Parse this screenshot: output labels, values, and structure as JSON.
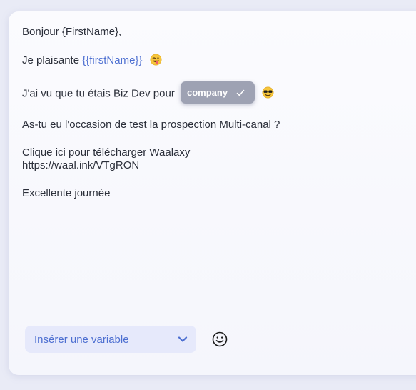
{
  "message": {
    "greeting": "Bonjour {FirstName},",
    "line2_text": "Je plaisante ",
    "line2_variable": "{{firstName}}",
    "line3_text": "J'ai vu que tu étais Biz Dev pour",
    "chip_label": "company",
    "line4": "As-tu eu l'occasion de test la prospection Multi-canal ?",
    "line5": "Clique ici pour télécharger Waalaxy",
    "line6": "https://waal.ink/VTgRON",
    "line7": "Excellente journée"
  },
  "toolbar": {
    "insert_variable_label": "Insérer une variable"
  },
  "colors": {
    "accent": "#4d6fd1",
    "chip_bg": "#9ea2b3",
    "select_bg": "#e6e9fb"
  },
  "icons": {
    "wink": "winking-tongue-face-icon",
    "sunglasses": "sunglasses-face-icon",
    "check": "check-icon",
    "chevron": "chevron-down-icon",
    "emoji": "smiley-icon"
  }
}
